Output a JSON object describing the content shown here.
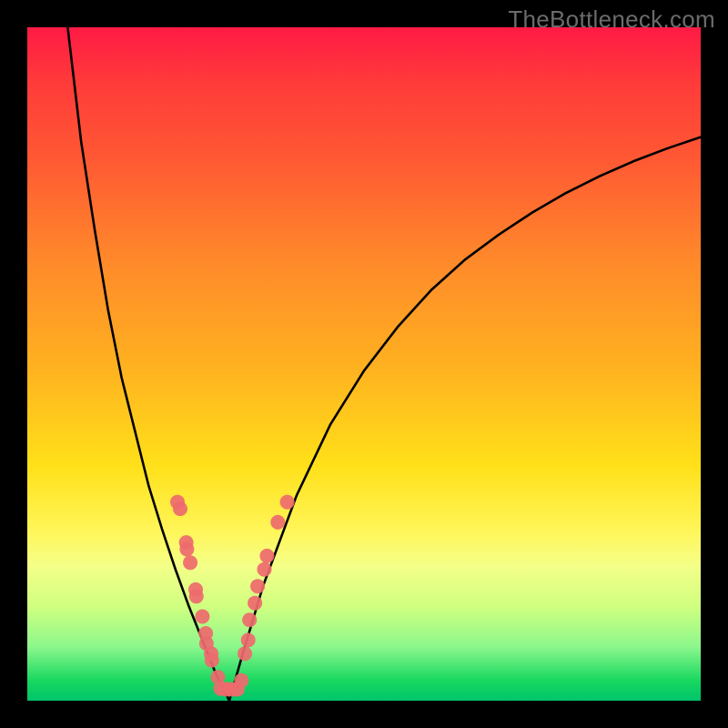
{
  "watermark": "TheBottleneck.com",
  "chart_data": {
    "type": "line",
    "title": "",
    "xlabel": "",
    "ylabel": "",
    "x_range": [
      0,
      100
    ],
    "y_range_pct": [
      0,
      100
    ],
    "left_curve": {
      "name": "bottleneck-left",
      "x": [
        6.0,
        8.0,
        10.0,
        12.0,
        14.0,
        16.0,
        18.0,
        20.0,
        22.0,
        24.0,
        26.0,
        27.0,
        28.0,
        29.0,
        30.0
      ],
      "y_pct": [
        0.0,
        17.0,
        30.0,
        42.0,
        52.0,
        60.0,
        68.0,
        74.5,
        80.5,
        86.0,
        91.0,
        93.5,
        96.0,
        98.0,
        100.0
      ]
    },
    "right_curve": {
      "name": "bottleneck-right",
      "x": [
        30.0,
        32.0,
        35.0,
        40.0,
        45.0,
        50.0,
        55.0,
        60.0,
        65.0,
        70.0,
        75.0,
        80.0,
        85.0,
        90.0,
        95.0,
        100.0
      ],
      "y_pct": [
        100.0,
        93.0,
        83.0,
        69.5,
        59.0,
        51.0,
        44.5,
        39.0,
        34.5,
        30.8,
        27.5,
        24.6,
        22.1,
        19.9,
        18.0,
        16.3
      ]
    },
    "dots": {
      "name": "sample-points",
      "color": "#ee6a6e",
      "radius_px": 8,
      "points": [
        {
          "x": 22.3,
          "y_pct": 70.5
        },
        {
          "x": 22.7,
          "y_pct": 71.5
        },
        {
          "x": 23.6,
          "y_pct": 76.5
        },
        {
          "x": 23.7,
          "y_pct": 77.5
        },
        {
          "x": 24.2,
          "y_pct": 79.5
        },
        {
          "x": 25.0,
          "y_pct": 83.5
        },
        {
          "x": 25.1,
          "y_pct": 84.5
        },
        {
          "x": 26.0,
          "y_pct": 87.5
        },
        {
          "x": 26.5,
          "y_pct": 90.0
        },
        {
          "x": 26.6,
          "y_pct": 91.5
        },
        {
          "x": 27.3,
          "y_pct": 93.0
        },
        {
          "x": 27.4,
          "y_pct": 94.0
        },
        {
          "x": 28.3,
          "y_pct": 96.5
        },
        {
          "x": 28.7,
          "y_pct": 98.2
        },
        {
          "x": 29.5,
          "y_pct": 98.3
        },
        {
          "x": 30.3,
          "y_pct": 98.3
        },
        {
          "x": 31.2,
          "y_pct": 98.3
        },
        {
          "x": 31.8,
          "y_pct": 97.0
        },
        {
          "x": 32.3,
          "y_pct": 93.0
        },
        {
          "x": 32.8,
          "y_pct": 91.0
        },
        {
          "x": 33.0,
          "y_pct": 88.0
        },
        {
          "x": 33.8,
          "y_pct": 85.5
        },
        {
          "x": 34.2,
          "y_pct": 83.0
        },
        {
          "x": 35.2,
          "y_pct": 80.5
        },
        {
          "x": 35.6,
          "y_pct": 78.5
        },
        {
          "x": 37.2,
          "y_pct": 73.5
        },
        {
          "x": 38.6,
          "y_pct": 70.5
        }
      ]
    }
  }
}
